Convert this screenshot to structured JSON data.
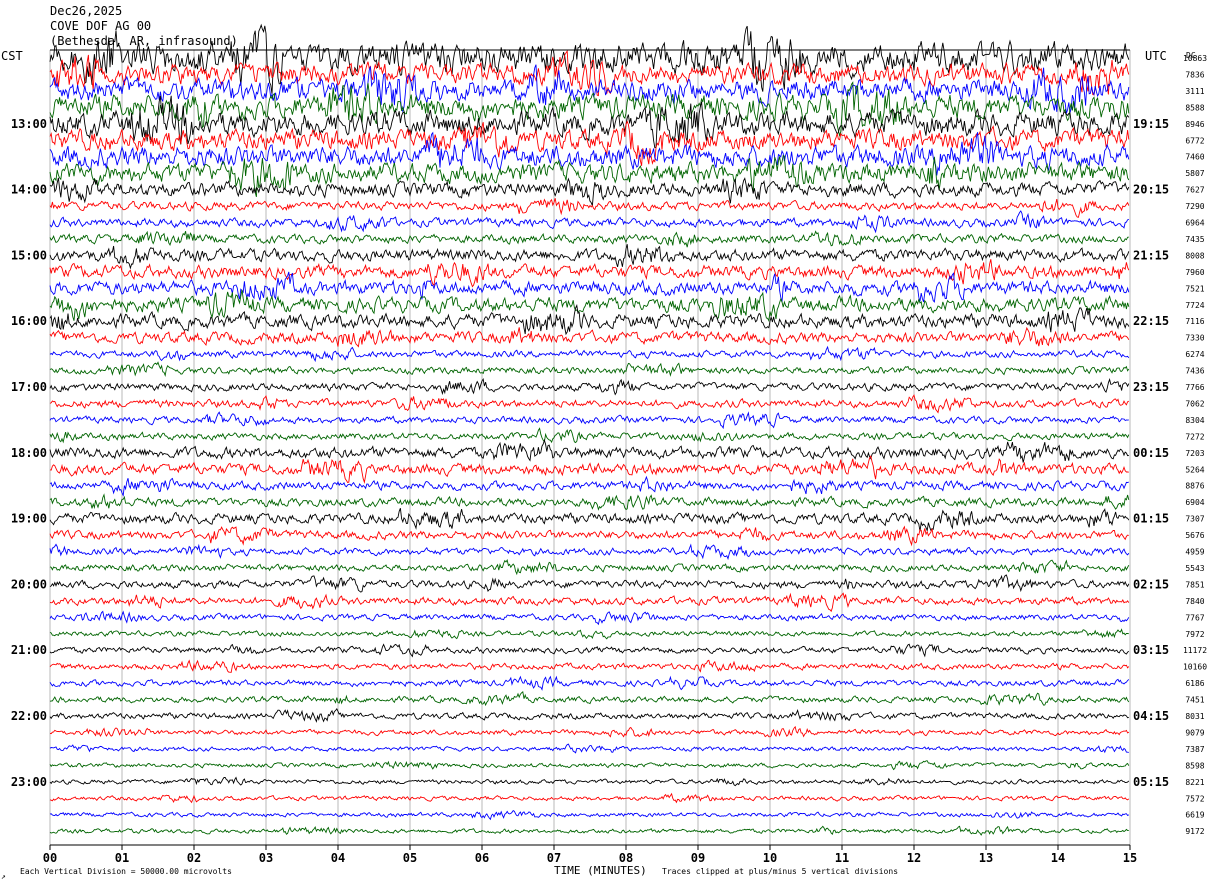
{
  "header": {
    "date": "Dec26,2025",
    "station": "COVE DOF AG 00",
    "location": "(Bethesda, AR, infrasound)"
  },
  "left_zone_label": "CST",
  "right_zone_label": "UTC",
  "right_column_label": "DC",
  "footer": {
    "scale_text": "Each Vertical Division = 50000.00 microvolts",
    "clip_text": "Traces clipped at plus/minus 5 vertical divisions",
    "corner_mark": "↗"
  },
  "chart_data": {
    "type": "helicorder",
    "xlabel": "TIME (MINUTES)",
    "x_ticks": [
      "00",
      "01",
      "02",
      "03",
      "04",
      "05",
      "06",
      "07",
      "08",
      "09",
      "10",
      "11",
      "12",
      "13",
      "14",
      "15"
    ],
    "xlim": [
      0,
      15
    ],
    "minutes_per_line": 15,
    "trace_colors": [
      "#000000",
      "#ff0000",
      "#0000ff",
      "#006400"
    ],
    "grid": true,
    "hour_labels_left": [
      "13:00",
      "14:00",
      "15:00",
      "16:00",
      "17:00",
      "18:00",
      "19:00",
      "20:00",
      "21:00",
      "22:00",
      "23:00"
    ],
    "hour_labels_right": [
      "19:15",
      "20:15",
      "21:15",
      "22:15",
      "23:15",
      "00:15",
      "01:15",
      "02:15",
      "03:15",
      "04:15",
      "05:15"
    ],
    "dc_offsets": [
      "10863",
      "7836",
      "3111",
      "8588",
      "8946",
      "6772",
      "7460",
      "5807",
      "7627",
      "7290",
      "6964",
      "7435",
      "8008",
      "7960",
      "7521",
      "7724",
      "7116",
      "7330",
      "6274",
      "7436",
      "7766",
      "7062",
      "8304",
      "7272",
      "7203",
      "5264",
      "8876",
      "6904",
      "7307",
      "5676",
      "4959",
      "5543",
      "7851",
      "7840",
      "7767",
      "7972",
      "11172",
      "10160",
      "6186",
      "7451",
      "8031",
      "9079",
      "7387",
      "8598",
      "8221",
      "7572",
      "6619",
      "9172"
    ],
    "trace_amplitude": [
      3.5,
      2.4,
      2.6,
      2.8,
      2.8,
      2.4,
      2.5,
      2.3,
      1.6,
      1.0,
      1.0,
      1.0,
      1.4,
      1.5,
      1.6,
      1.7,
      1.6,
      1.3,
      0.8,
      0.8,
      0.9,
      0.9,
      0.8,
      0.8,
      1.3,
      1.3,
      1.0,
      1.0,
      1.2,
      1.0,
      0.8,
      0.8,
      0.9,
      0.9,
      0.7,
      0.6,
      0.7,
      0.7,
      0.7,
      0.7,
      0.7,
      0.6,
      0.5,
      0.5,
      0.5,
      0.5,
      0.5,
      0.5
    ]
  }
}
